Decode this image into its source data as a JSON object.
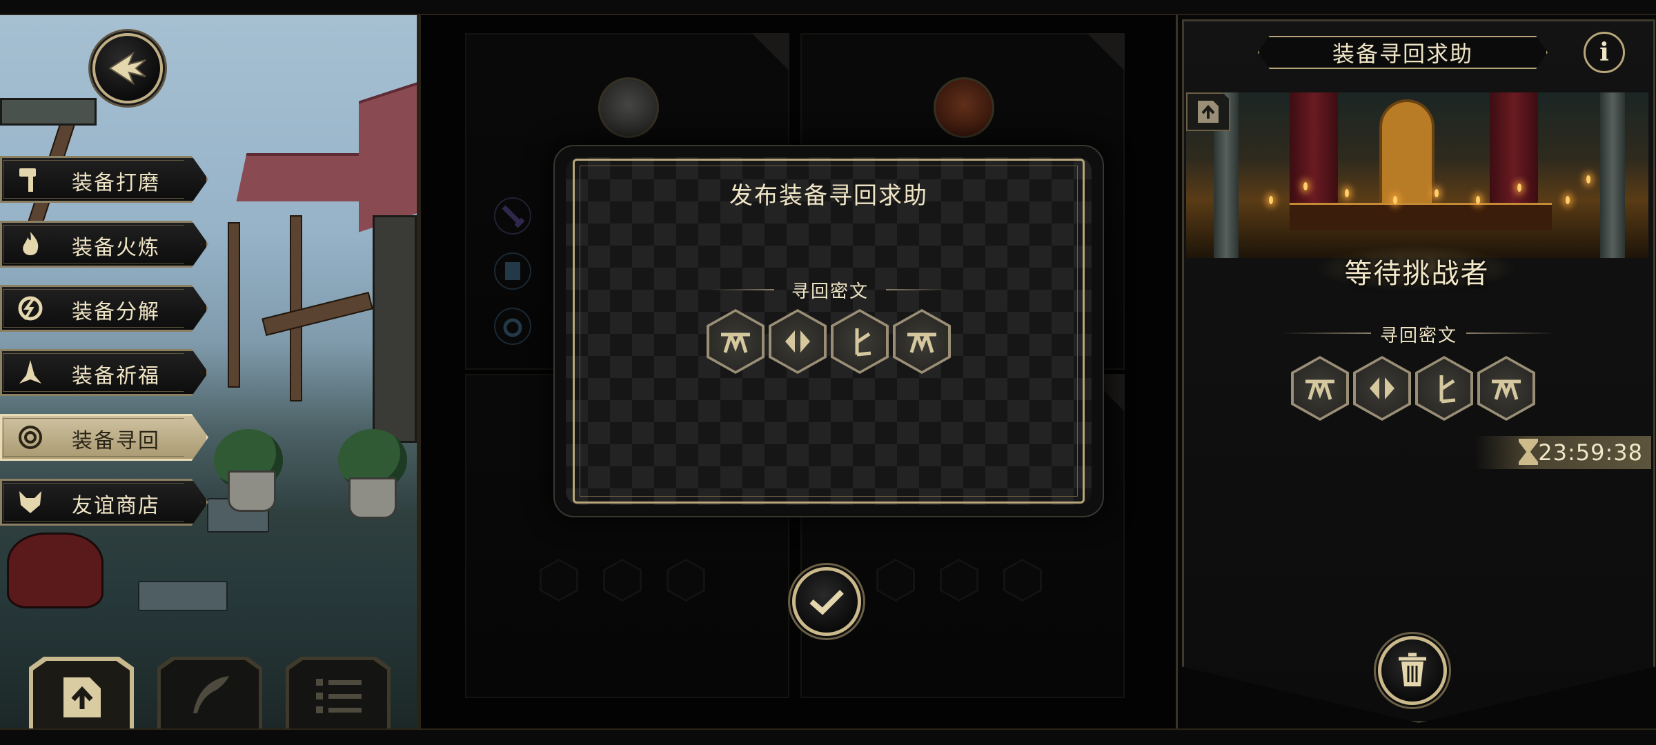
{
  "menu": {
    "items": [
      {
        "label": "装备打磨",
        "icon": "hammer-icon",
        "active": false
      },
      {
        "label": "装备火炼",
        "icon": "flame-icon",
        "active": false
      },
      {
        "label": "装备分解",
        "icon": "break-icon",
        "active": false
      },
      {
        "label": "装备祈福",
        "icon": "pray-icon",
        "active": false
      },
      {
        "label": "装备寻回",
        "icon": "spiral-icon",
        "active": true
      },
      {
        "label": "友谊商店",
        "icon": "fox-icon",
        "active": false
      }
    ]
  },
  "dialog": {
    "title": "发布装备寻回求助",
    "cipher_label": "寻回密文",
    "runes": [
      "rune-arch-icon",
      "rune-split-icon",
      "rune-branch-icon",
      "rune-arch-icon"
    ]
  },
  "right_panel": {
    "title": "装备寻回求助",
    "status": "等待挑战者",
    "cipher_label": "寻回密文",
    "runes": [
      "rune-arch-icon",
      "rune-split-icon",
      "rune-branch-icon",
      "rune-arch-icon"
    ],
    "timer": "23:59:38"
  },
  "colors": {
    "gold": "#b8a67a",
    "text": "#efe4c5",
    "active_tab": "#cfc2a0"
  }
}
